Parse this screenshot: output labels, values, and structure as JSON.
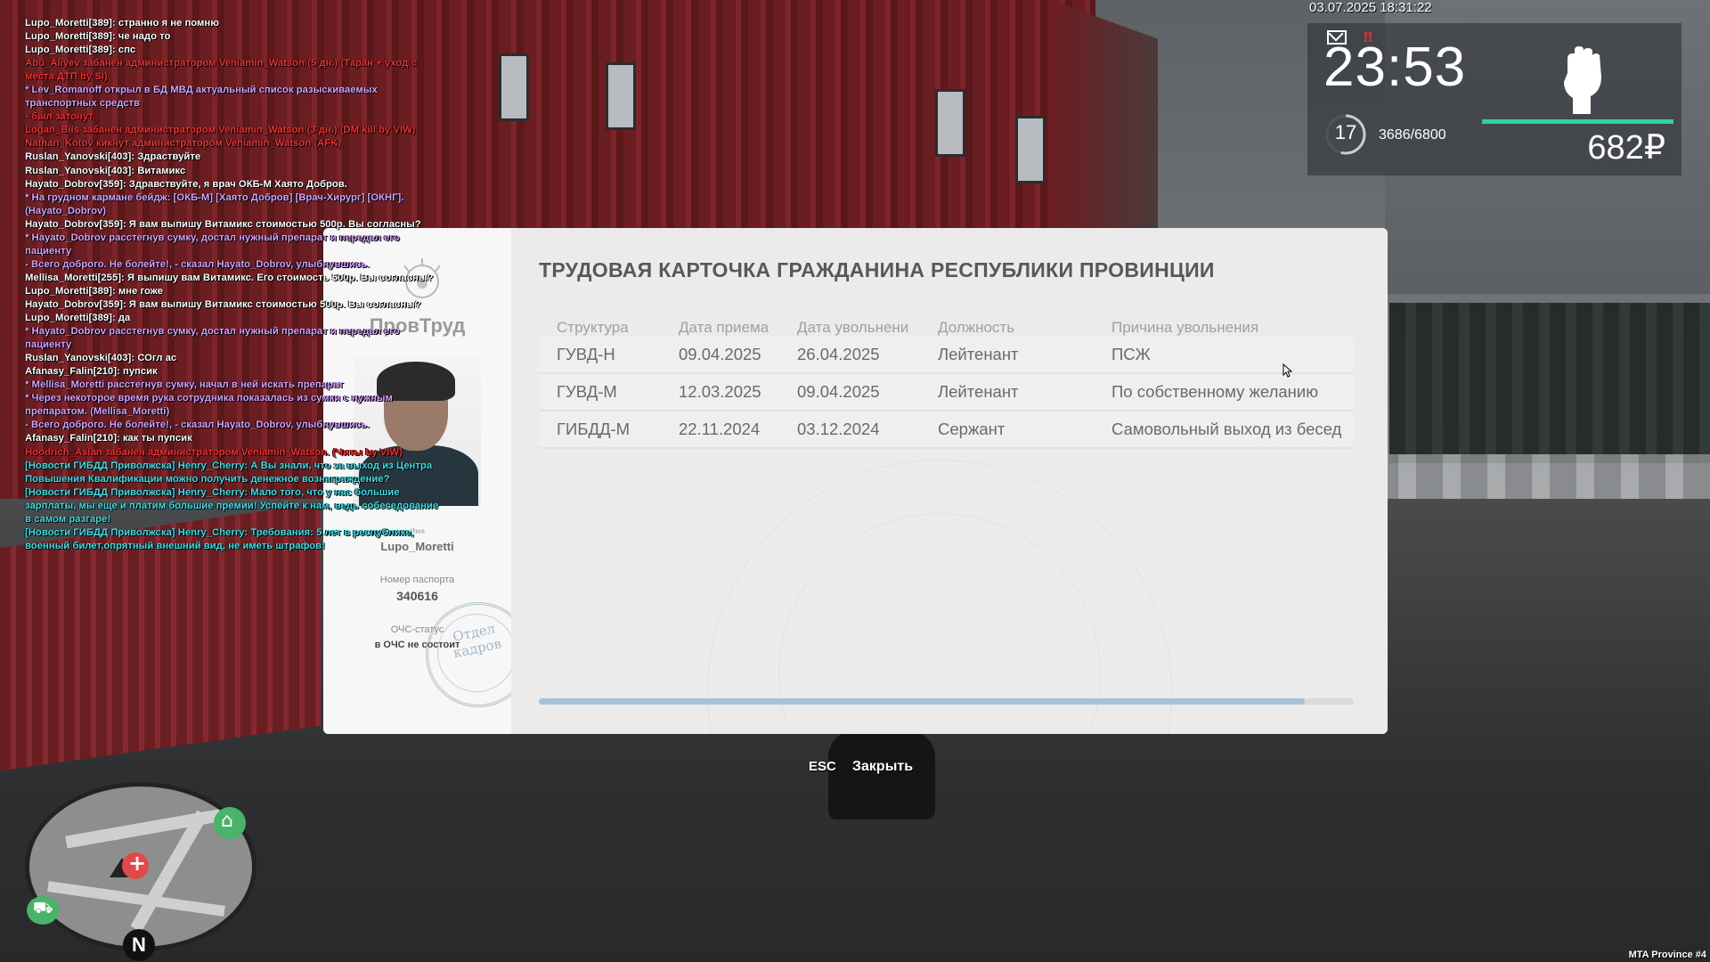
{
  "chat": [
    {
      "text": "Lupo_Moretti[389]: странно я не помню",
      "color": "#ffffff"
    },
    {
      "text": "Lupo_Moretti[389]: че надо то",
      "color": "#ffffff"
    },
    {
      "text": "Lupo_Moretti[389]: спс",
      "color": "#ffffff"
    },
    {
      "text": "Abu_Aliyev забанен администратором Veniamin_Watson (5 дн.) (Таран + уход с места ДТП by SI)",
      "color": "#ff2a2a"
    },
    {
      "text": "* Lev_Romanoff открыл в БД МВД актуальный список разыскиваемых транспортных средств",
      "color": "#d8a0ff"
    },
    {
      "text": "- был затонут",
      "color": "#ff2a2a"
    },
    {
      "text": "Logan_Bils забанен администратором Veniamin_Watson (3 дн.) (DM kill by VIW)",
      "color": "#ff2a2a"
    },
    {
      "text": "Nathan_Kotov кикнут администратором Veniamin_Watson (AFK)",
      "color": "#ff2a2a"
    },
    {
      "text": "Ruslan_Yanovski[403]: Здраствуйте",
      "color": "#ffffff"
    },
    {
      "text": "Ruslan_Yanovski[403]: Витамикс",
      "color": "#ffffff"
    },
    {
      "text": "Hayato_Dobrov[359]: Здравствуйте, я врач ОКБ-М Хаято Добров.",
      "color": "#ffffff",
      "prefix": "Hayato_Dobrov[359]:",
      "prefixColor": "#ff5a5a"
    },
    {
      "text": "* На грудном кармане бейдж: [ОКБ-М] [Хаято Добров] [Врач-Хирург] [ОКНГ]. (Hayato_Dobrov)",
      "color": "#d8a0ff"
    },
    {
      "text": "Hayato_Dobrov[359]: Я вам выпишу Витамикс стоимостью 500р. Вы согласны?",
      "color": "#ffffff"
    },
    {
      "text": "* Hayato_Dobrov расстегнув сумку, достал нужный препарат и передал его пациенту",
      "color": "#d8a0ff"
    },
    {
      "text": "- Всего доброго. Не болейте!, - сказал Hayato_Dobrov, улыбнувшись.",
      "color": "#d8a0ff"
    },
    {
      "text": "Mellisa_Moretti[255]: Я выпишу вам Витамикс. Его стоимость 500р. Вы согласны?",
      "color": "#ffffff"
    },
    {
      "text": "Lupo_Moretti[389]: мне гоже",
      "color": "#ffffff"
    },
    {
      "text": "Hayato_Dobrov[359]: Я вам выпишу Витамикс стоимостью 500р. Вы согласны?",
      "color": "#ffffff"
    },
    {
      "text": "Lupo_Moretti[389]: да",
      "color": "#ffffff"
    },
    {
      "text": "* Hayato_Dobrov расстегнув сумку, достал нужный препарат и передал его пациенту",
      "color": "#d8a0ff"
    },
    {
      "text": "Ruslan_Yanovski[403]: СОгл ас",
      "color": "#ffffff"
    },
    {
      "text": "Afanasy_Falin[210]: пупсик",
      "color": "#ffffff"
    },
    {
      "text": "* Mellisa_Moretti расстегнув сумку, начал в ней искать препарат",
      "color": "#d8a0ff"
    },
    {
      "text": "* Через некоторое время рука сотрудника показалась из сумки с нужным препаратом. (Mellisa_Moretti)",
      "color": "#d8a0ff"
    },
    {
      "text": "- Всего доброго. Не болейте!, - сказал Hayato_Dobrov, улыбнувшись.",
      "color": "#d8a0ff"
    },
    {
      "text": "Afanasy_Falin[210]: как ты пупсик",
      "color": "#ffffff"
    },
    {
      "text": "Hoodrich_Asian забанен администратором Veniamin_Watson. (Читы by VIW)",
      "color": "#ff2a2a"
    },
    {
      "text": "[Новости ГИБДД Приволжска] Henry_Cherry: А Вы знали, что за выход из Центра Повышения Квалификации можно получить денежное вознаграждение?",
      "color": "#36e0e8"
    },
    {
      "text": "[Новости ГИБДД Приволжска] Henry_Cherry: Мало того, что у нас большие зарплаты, мы еще и платим большие премии! Успейте к нам, ведь собеседование в самом разгаре!",
      "color": "#36e0e8"
    },
    {
      "text": "[Новости ГИБДД Приволжска] Henry_Cherry: Требования: 5 лет в республике, военный билет,опрятный внешний вид, не иметь штрафов!",
      "color": "#36e0e8"
    }
  ],
  "hud": {
    "datetime": "03.07.2025 18:31:22",
    "time": "23:53",
    "level": "17",
    "level_progress": 0.54,
    "exp": "3686/6800",
    "health": 1.0,
    "money": "682₽",
    "fist_icon": "fist-icon",
    "mail_icon": "mail-icon",
    "alert_icon": "alert-icon",
    "alert_glyph": "‼"
  },
  "card": {
    "title": "ТРУДОВАЯ КАРТОЧКА ГРАЖДАНИНА РЕСПУБЛИКИ ПРОВИНЦИИ",
    "brand": "ПровТруд",
    "name_caption": "Имя",
    "name": "Lupo_Moretti",
    "passport_caption": "Номер паспорта",
    "passport": "340616",
    "ochs_caption": "ОЧС-статус",
    "ochs": "в ОЧС не состоит",
    "stamp": "Отдел кадров",
    "columns": [
      "Структура",
      "Дата приема",
      "Дата увольнени",
      "Должность",
      "Причина увольнения"
    ],
    "rows": [
      [
        "ГУВД-Н",
        "09.04.2025",
        "26.04.2025",
        "Лейтенант",
        "ПСЖ"
      ],
      [
        "ГУВД-М",
        "12.03.2025",
        "09.04.2025",
        "Лейтенант",
        "По собственному желанию"
      ],
      [
        "ГИБДД-М",
        "22.11.2024",
        "03.12.2024",
        "Сержант",
        "Самовольный выход из бесед"
      ]
    ],
    "scroll_fraction": 0.94
  },
  "footer": {
    "esc": "ESC",
    "close": "Закрыть"
  },
  "minimap": {
    "north": "N"
  },
  "server": "MTA Province #4",
  "colors": {
    "accent": "#2fd39a",
    "scroll": "#a7c2d6"
  }
}
